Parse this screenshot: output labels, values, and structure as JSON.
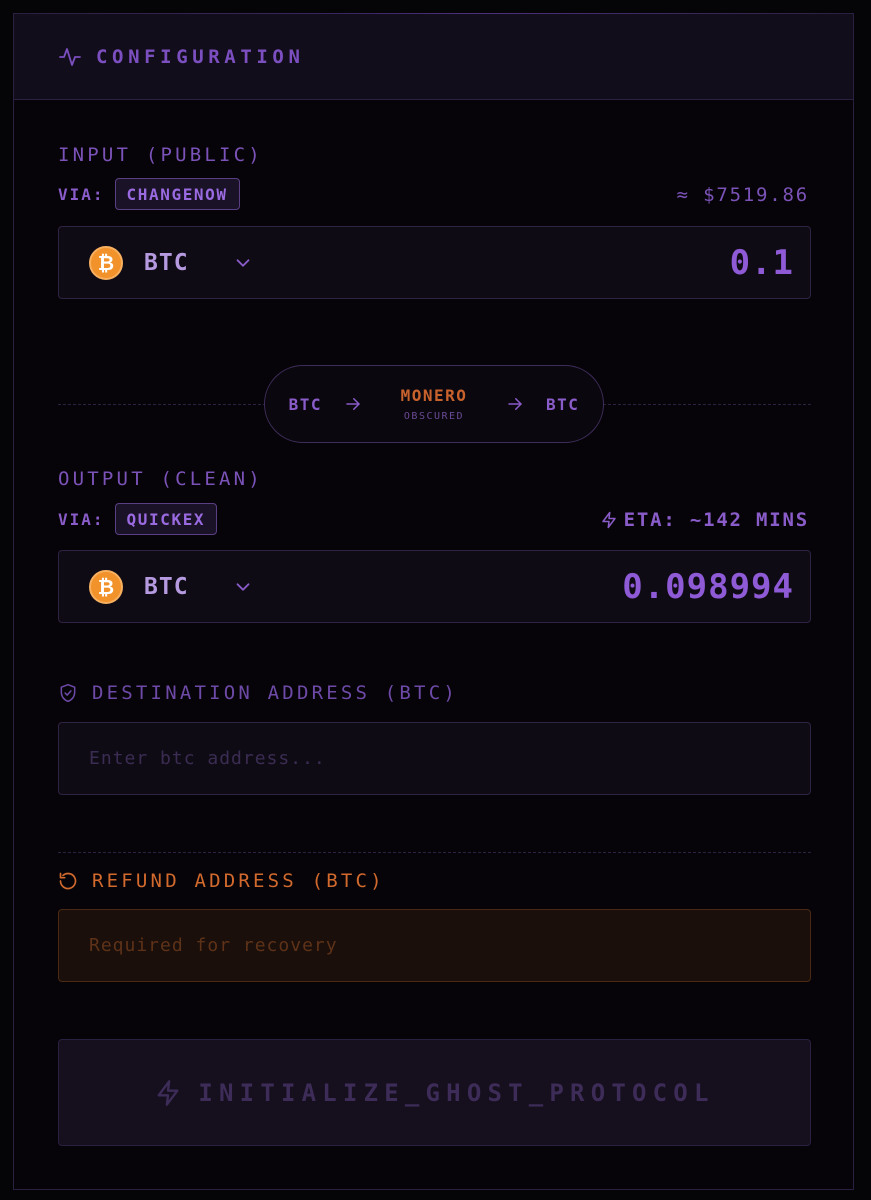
{
  "header": {
    "title": "CONFIGURATION",
    "icon": "activity-icon"
  },
  "input": {
    "label": "INPUT (PUBLIC)",
    "via_label": "VIA:",
    "provider": "CHANGENOW",
    "usd_estimate": "≈ $7519.86",
    "asset": "BTC",
    "coin_symbol": "₿",
    "amount": "0.1"
  },
  "route": {
    "from": "BTC",
    "via": "MONERO",
    "via_sub": "OBSCURED",
    "to": "BTC"
  },
  "output": {
    "label": "OUTPUT (CLEAN)",
    "via_label": "VIA:",
    "provider": "QUICKEX",
    "eta": "ETA: ~142 MINS",
    "asset": "BTC",
    "coin_symbol": "₿",
    "amount": "0.098994"
  },
  "destination": {
    "label": "DESTINATION ADDRESS (BTC)",
    "placeholder": "Enter btc address...",
    "value": ""
  },
  "refund": {
    "label": "REFUND ADDRESS (BTC)",
    "placeholder": "Required for recovery",
    "value": ""
  },
  "cta": {
    "label": "INITIALIZE_GHOST_PROTOCOL"
  },
  "colors": {
    "accent": "#8a5cc9",
    "warning": "#d2692d",
    "background": "#050406",
    "bitcoin": "#f2922b"
  }
}
